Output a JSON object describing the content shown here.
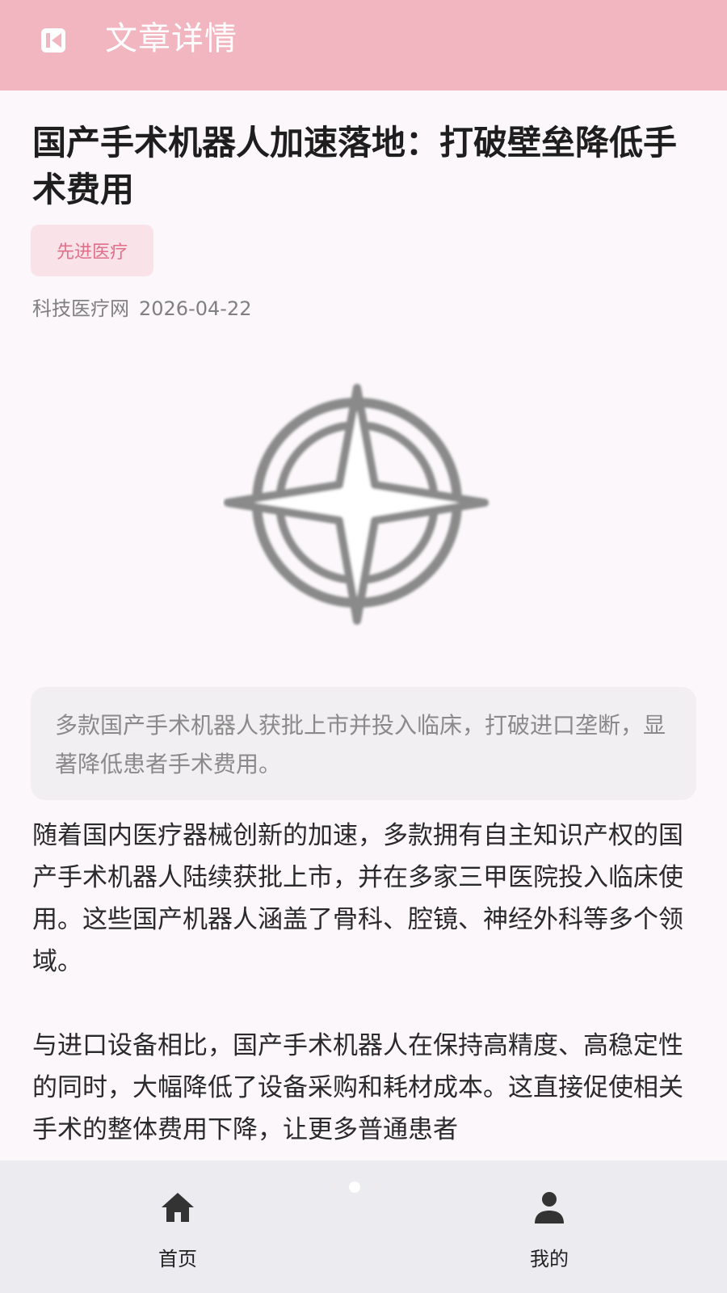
{
  "app_bar": {
    "back_icon": "back-icon",
    "title": "文章详情"
  },
  "article": {
    "title": "国产手术机器人加速落地：打破壁垒降低手术费用",
    "tag": "先进医疗",
    "source": "科技医疗网",
    "date": "2026-04-22",
    "hero_icon": "compass-icon",
    "summary": "多款国产手术机器人获批上市并投入临床，打破进口垄断，显著降低患者手术费用。",
    "paragraphs": [
      "随着国内医疗器械创新的加速，多款拥有自主知识产权的国产手术机器人陆续获批上市，并在多家三甲医院投入临床使用。这些国产机器人涵盖了骨科、腔镜、神经外科等多个领域。",
      "与进口设备相比，国产手术机器人在保持高精度、高稳定性的同时，大幅降低了设备采购和耗材成本。这直接促使相关手术的整体费用下降，让更多普通患者"
    ]
  },
  "bottom_nav": {
    "items": [
      {
        "label": "首页",
        "icon": "home-icon"
      },
      {
        "label": "我的",
        "icon": "person-icon"
      }
    ],
    "page_indicator": {
      "count": 3,
      "active_index": 1
    }
  },
  "colors": {
    "app_bar": "#f2b6c0",
    "tag_bg": "#f9e3e8",
    "tag_text": "#e06f8a",
    "background": "#fbf7fa",
    "bottom_nav": "#ececf0"
  }
}
